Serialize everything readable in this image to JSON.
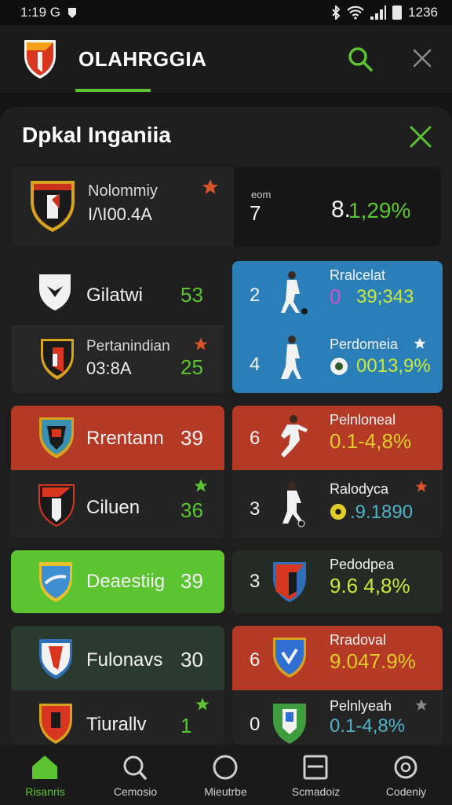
{
  "status": {
    "time": "1:19 G",
    "battery": "1236"
  },
  "header": {
    "title": "OLAHRGGIA"
  },
  "panel": {
    "title": "Dpkal Inganiia"
  },
  "featured": {
    "name": "Nolommiy",
    "code": "I/\\I00.4A",
    "small_label": "eom",
    "rank": "7",
    "percent_main": "8.",
    "percent_accent": "1,29%"
  },
  "left_rows": [
    {
      "name": "Gilatwi",
      "score": "53"
    },
    {
      "name": "Pertanindian",
      "subtitle": "03:8A",
      "score": "25"
    },
    {
      "name": "Rrentann",
      "score": "39"
    },
    {
      "name": "Ciluen",
      "score": "36"
    },
    {
      "name": "Deaestiig",
      "score": "39"
    },
    {
      "name": "Fulonavs",
      "score": "30"
    },
    {
      "name": "Tiurallv",
      "score": "1"
    }
  ],
  "right_rows": [
    {
      "rank": "2",
      "label": "Rralcelat",
      "value_prefix": "0",
      "value": "39;343"
    },
    {
      "rank": "4",
      "label": "Perdomeia",
      "value": "0013,9%"
    },
    {
      "rank": "6",
      "label": "Pelnloneal",
      "value": "0.1-4,8%"
    },
    {
      "rank": "3",
      "label": "Ralodyca",
      "value": ".9.1890"
    },
    {
      "rank": "3",
      "label": "Pedodpea",
      "value": "9.6 4,8%"
    },
    {
      "rank": "6",
      "label": "Rradoval",
      "value": "9.047.9%"
    },
    {
      "rank": "0",
      "label": "Pelnlyeah",
      "value": "0.1-4,8%"
    }
  ],
  "nav": [
    {
      "label": "Risanris",
      "icon": "home-icon",
      "active": true
    },
    {
      "label": "Cemosio",
      "icon": "search-icon",
      "active": false
    },
    {
      "label": "Mieutrbe",
      "icon": "circle-icon",
      "active": false
    },
    {
      "label": "Scmadoiz",
      "icon": "calendar-icon",
      "active": false
    },
    {
      "label": "Codeniy",
      "icon": "settings-icon",
      "active": false
    }
  ],
  "colors": {
    "accent_green": "#5cc431",
    "red_card": "#b43a26",
    "blue_card": "#2b7fb8",
    "yellow_value": "#e0cc29",
    "star_orange": "#d9542b"
  }
}
